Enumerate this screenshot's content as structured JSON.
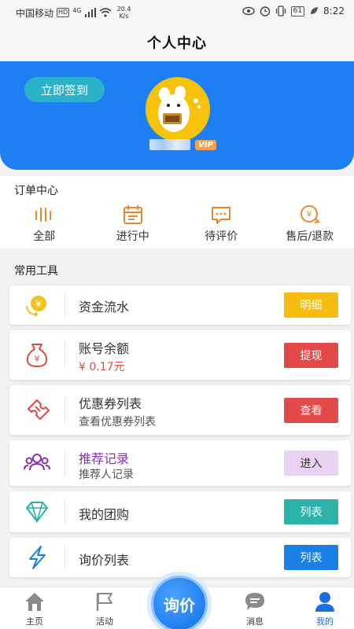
{
  "status": {
    "carrier": "中国移动",
    "hd": "HD",
    "net_type": "4G",
    "speed_value": "20.4",
    "speed_unit": "K/s",
    "battery": "61",
    "time": "8:22"
  },
  "header": {
    "title": "个人中心"
  },
  "profile": {
    "signin_label": "立即签到",
    "vip_badge": "VIP"
  },
  "orders": {
    "title": "订单中心",
    "items": [
      {
        "label": "全部",
        "icon": "bars-icon"
      },
      {
        "label": "进行中",
        "icon": "calendar-icon"
      },
      {
        "label": "待评价",
        "icon": "comment-icon"
      },
      {
        "label": "售后/退款",
        "icon": "refund-icon"
      }
    ]
  },
  "tools": {
    "title": "常用工具",
    "items": [
      {
        "name": "资金流水",
        "button": "明细",
        "icon": "coin-flow-icon",
        "button_color": "#f5bd10"
      },
      {
        "name": "账号余额",
        "sub": "¥ 0.17元",
        "button": "提现",
        "icon": "money-bag-icon",
        "button_color": "#e24a4a"
      },
      {
        "name": "优惠券列表",
        "sub": "查看优惠券列表",
        "button": "查看",
        "icon": "coupon-icon",
        "button_color": "#e24a4a"
      },
      {
        "name": "推荐记录",
        "sub": "推荐人记录",
        "button": "进入",
        "icon": "people-icon",
        "button_color": "#ead3f2"
      },
      {
        "name": "我的团购",
        "button": "列表",
        "icon": "diamond-icon",
        "button_color": "#2bb3a9"
      },
      {
        "name": "询价列表",
        "button": "列表",
        "icon": "lightning-icon",
        "button_color": "#1b7fe8"
      }
    ]
  },
  "tabbar": {
    "home": "主页",
    "activity": "活动",
    "center_button": "询价",
    "messages": "消息",
    "mine": "我的"
  },
  "colors": {
    "brand_blue": "#1e7ff5",
    "order_icon_orange": "#e9892d",
    "active_tab": "#1b6fe0"
  }
}
